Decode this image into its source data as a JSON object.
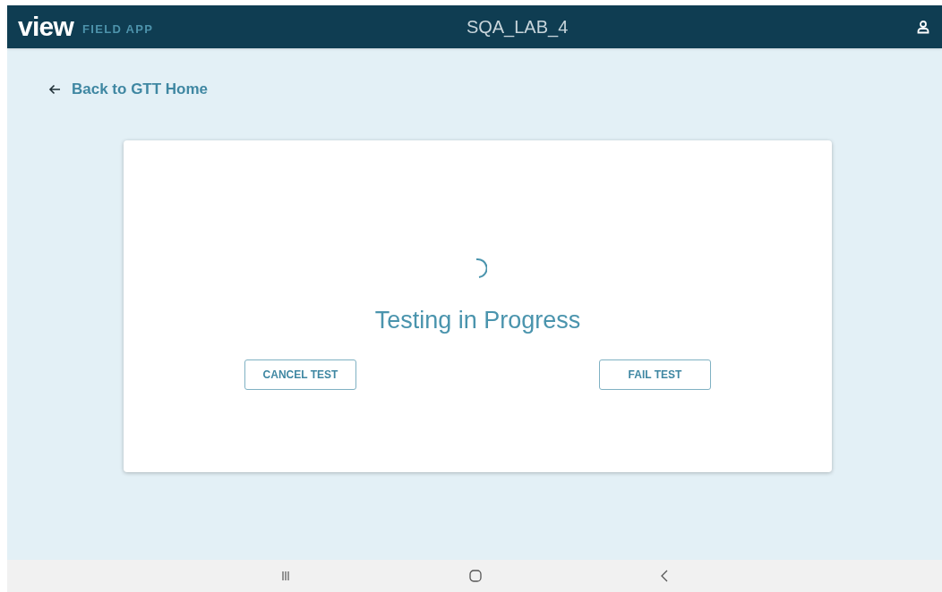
{
  "header": {
    "logo": "view",
    "app_name": "FIELD APP",
    "site": "SQA_LAB_4"
  },
  "back_link": {
    "label": "Back to GTT Home"
  },
  "card": {
    "status": "Testing in Progress",
    "buttons": [
      {
        "label": "CANCEL TEST"
      },
      {
        "label": "FAIL TEST"
      }
    ]
  }
}
